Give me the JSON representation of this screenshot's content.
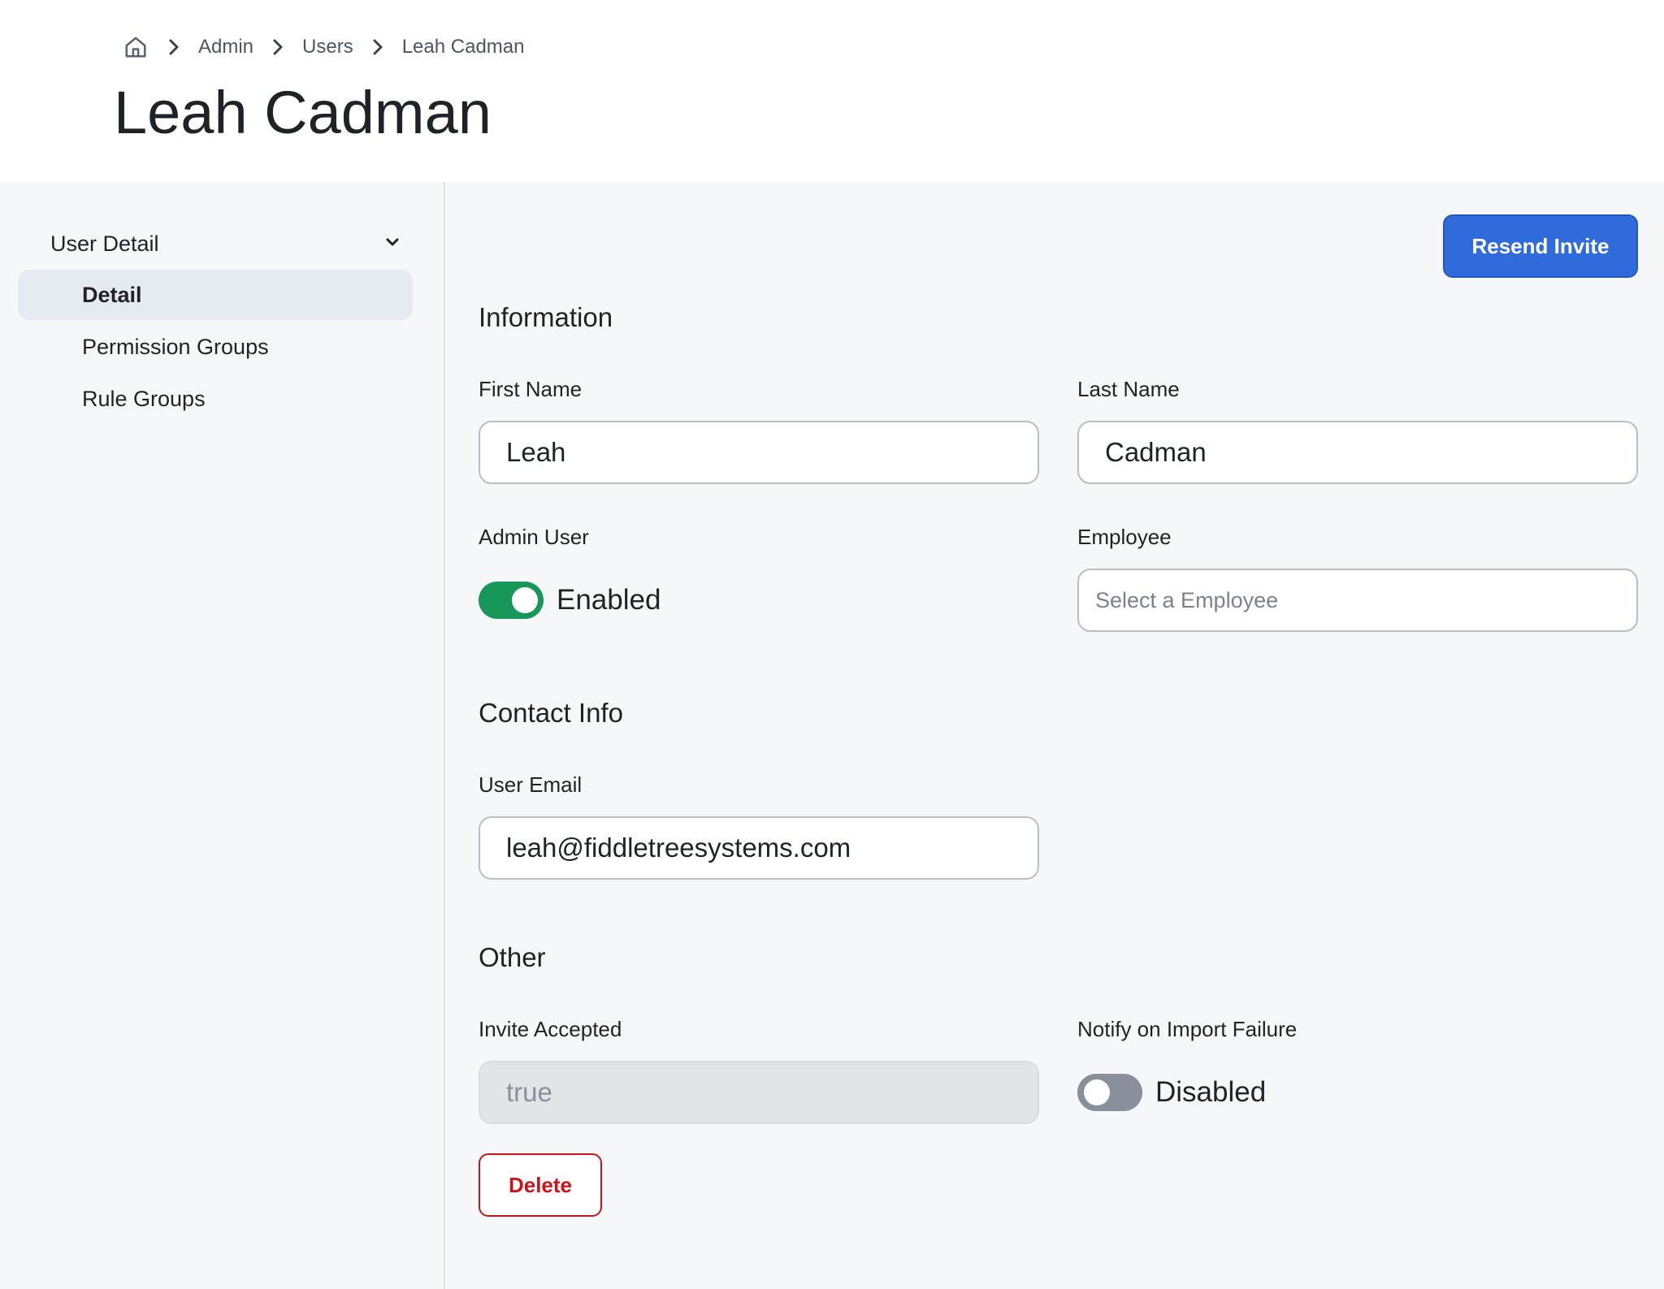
{
  "breadcrumb": {
    "home_icon": "home-icon",
    "items": [
      {
        "label": "Admin"
      },
      {
        "label": "Users"
      },
      {
        "label": "Leah Cadman"
      }
    ]
  },
  "page": {
    "title": "Leah Cadman"
  },
  "sidebar": {
    "group_label": "User Detail",
    "items": [
      {
        "label": "Detail",
        "active": true
      },
      {
        "label": "Permission Groups",
        "active": false
      },
      {
        "label": "Rule Groups",
        "active": false
      }
    ]
  },
  "actions": {
    "resend_invite": "Resend Invite",
    "delete": "Delete"
  },
  "sections": {
    "information": {
      "title": "Information",
      "first_name": {
        "label": "First Name",
        "value": "Leah"
      },
      "last_name": {
        "label": "Last Name",
        "value": "Cadman"
      },
      "admin_user": {
        "label": "Admin User",
        "state": "Enabled",
        "on": true
      },
      "employee": {
        "label": "Employee",
        "placeholder": "Select a Employee"
      }
    },
    "contact": {
      "title": "Contact Info",
      "email": {
        "label": "User Email",
        "value": "leah@fiddletreesystems.com"
      }
    },
    "other": {
      "title": "Other",
      "invite_accepted": {
        "label": "Invite Accepted",
        "value": "true"
      },
      "notify_import_failure": {
        "label": "Notify on Import Failure",
        "state": "Disabled",
        "on": false
      }
    }
  },
  "colors": {
    "primary": "#2f6bdb",
    "toggle_on": "#18975a",
    "toggle_off": "#8a8f9c",
    "danger": "#c8151b",
    "sidebar_active": "#e6ebf2"
  }
}
